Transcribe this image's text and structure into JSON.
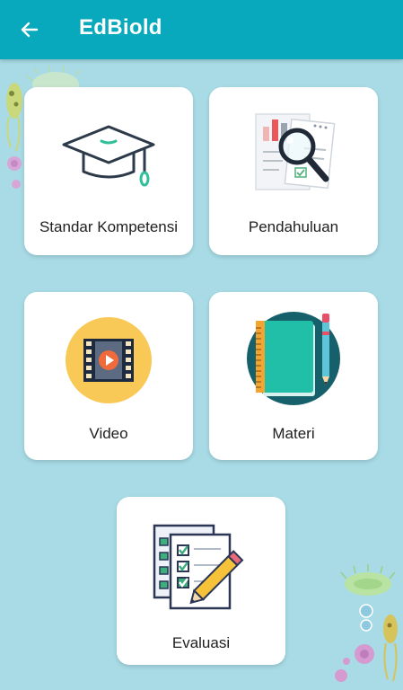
{
  "app_bar": {
    "title": "EdBiold",
    "back_icon": "arrow-left-icon",
    "background": "#09a9bd"
  },
  "menu": [
    {
      "label": "Standar Kompetensi",
      "icon": "graduation-cap-icon"
    },
    {
      "label": "Pendahuluan",
      "icon": "document-magnifier-icon"
    },
    {
      "label": "Video",
      "icon": "video-play-icon"
    },
    {
      "label": "Materi",
      "icon": "notebook-pen-icon"
    },
    {
      "label": "Evaluasi",
      "icon": "checklist-pencil-icon"
    }
  ],
  "colors": {
    "page_background": "#a8dbe6",
    "card_background": "#ffffff",
    "accent": "#09a9bd"
  }
}
